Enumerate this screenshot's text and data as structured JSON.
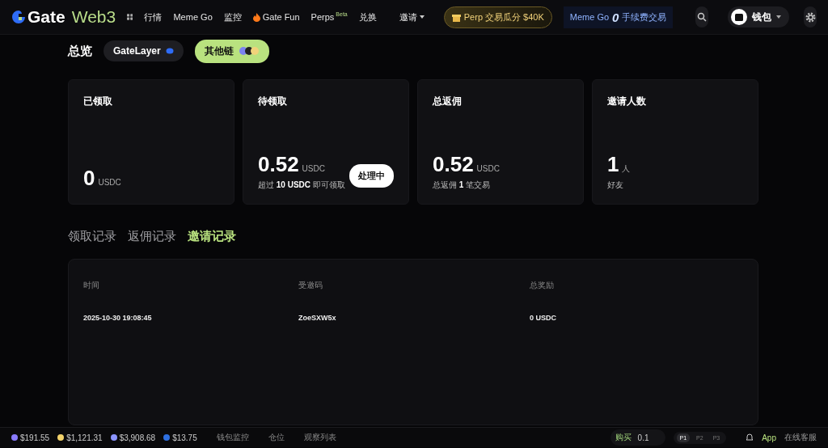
{
  "header": {
    "logo": {
      "brand": "Gate",
      "suffix": "Web3"
    },
    "nav": [
      {
        "label": "行情",
        "kind": "link"
      },
      {
        "label": "Meme Go",
        "kind": "link"
      },
      {
        "label": "监控",
        "kind": "link"
      },
      {
        "label": "Gate Fun",
        "kind": "fire"
      },
      {
        "label": "Perps",
        "kind": "badge",
        "badge": "Beta"
      },
      {
        "label": "兑换",
        "kind": "link"
      },
      {
        "label": "邀请",
        "kind": "menu"
      }
    ],
    "promo": "Perp 交易瓜分 $40K",
    "meme_promo": {
      "label": "Meme Go",
      "figure": "0",
      "text": "手续费交易"
    },
    "wallet": "钱包"
  },
  "overview": {
    "title": "总览",
    "chains": [
      {
        "label": "GateLayer",
        "selected": false
      },
      {
        "label": "其他链",
        "selected": true
      }
    ]
  },
  "cards": [
    {
      "title": "已领取",
      "value": "0",
      "unit": "USDC"
    },
    {
      "title": "待领取",
      "value": "0.52",
      "unit": "USDC",
      "note": "超过 **10 USDC** 即可领取",
      "action": "处理中"
    },
    {
      "title": "总返佣",
      "value": "0.52",
      "unit": "USDC",
      "note": "总返佣 **1** 笔交易"
    },
    {
      "title": "邀请人数",
      "value": "1",
      "unit": "人",
      "note": "好友"
    }
  ],
  "records": {
    "tabs": [
      {
        "label": "领取记录",
        "selected": false
      },
      {
        "label": "返佣记录",
        "selected": false
      },
      {
        "label": "邀请记录",
        "selected": true
      }
    ],
    "table": {
      "columns": [
        "时间",
        "受邀码",
        "总奖励"
      ],
      "rows": [
        [
          "2025-10-30 19:08:45",
          "ZoeSXW5x",
          "0 USDC"
        ]
      ]
    }
  },
  "footer": {
    "prices": [
      {
        "color": "#8a7bff",
        "value": "$191.55"
      },
      {
        "color": "#f3d36b",
        "value": "$1,121.31"
      },
      {
        "color": "#8c95ff",
        "value": "$3,908.68"
      },
      {
        "color": "#2e6fe0",
        "value": "$13.75"
      }
    ],
    "links": [
      "钱包监控",
      "仓位",
      "观察列表"
    ],
    "buy": {
      "label": "购买",
      "amount": "0.1"
    },
    "presets": [
      {
        "label": "P1",
        "selected": true
      },
      {
        "label": "P2",
        "selected": false
      },
      {
        "label": "P3",
        "selected": false
      }
    ],
    "app": "App",
    "support": "在线客服"
  }
}
